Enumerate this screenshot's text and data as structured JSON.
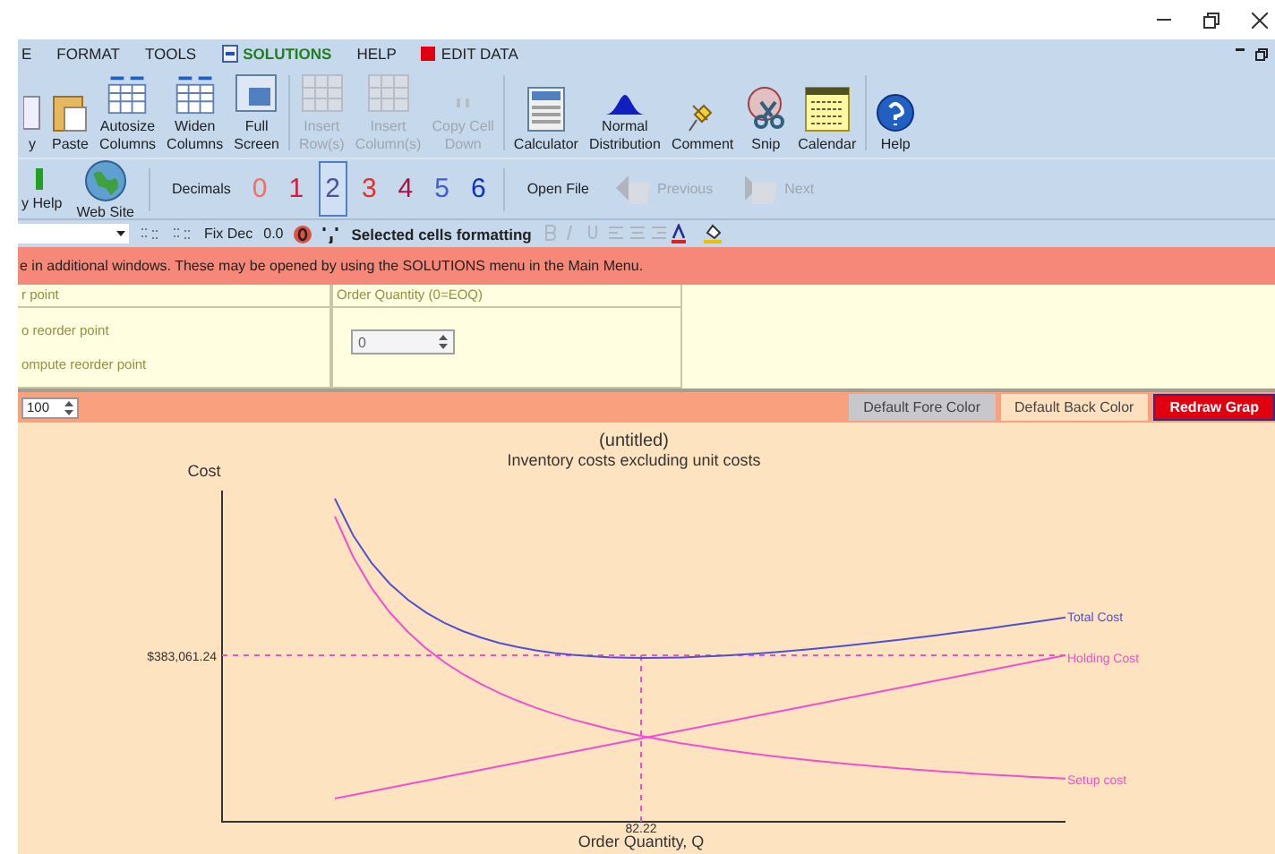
{
  "menu": [
    {
      "label": "E",
      "kind": "plain"
    },
    {
      "label": "FORMAT",
      "kind": "plain"
    },
    {
      "label": "TOOLS",
      "kind": "plain"
    },
    {
      "label": "SOLUTIONS",
      "kind": "solutions"
    },
    {
      "label": "HELP",
      "kind": "plain"
    },
    {
      "label": "EDIT DATA",
      "kind": "edit"
    }
  ],
  "toolbar": [
    {
      "label": "y",
      "kind": "copy",
      "disabled": false
    },
    {
      "label": "Paste",
      "kind": "paste",
      "disabled": false
    },
    {
      "label": "Autosize\nColumns",
      "kind": "grid-arrows",
      "disabled": false
    },
    {
      "label": "Widen\nColumns",
      "kind": "grid-arrows",
      "disabled": false
    },
    {
      "label": "Full\nScreen",
      "kind": "screen",
      "disabled": false
    },
    {
      "label": "Insert\nRow(s)",
      "kind": "grid",
      "disabled": true
    },
    {
      "label": "Insert\nColumn(s)",
      "kind": "grid",
      "disabled": true
    },
    {
      "label": "Copy Cell\nDown",
      "kind": "quote",
      "disabled": true
    },
    {
      "label": "Calculator",
      "kind": "calculator",
      "disabled": false
    },
    {
      "label": "Normal\nDistribution",
      "kind": "bell",
      "disabled": false
    },
    {
      "label": "Comment",
      "kind": "pin",
      "disabled": false
    },
    {
      "label": "Snip",
      "kind": "snip",
      "disabled": false
    },
    {
      "label": "Calendar",
      "kind": "calendar",
      "disabled": false
    },
    {
      "label": "Help",
      "kind": "help",
      "disabled": false
    }
  ],
  "row2": {
    "links": [
      {
        "label": "y Help",
        "kind": "help-link"
      },
      {
        "label": "Web Site",
        "kind": "globe"
      }
    ],
    "decimals_label": "Decimals",
    "decimals": [
      {
        "label": "0",
        "color": "#f07060",
        "selected": false
      },
      {
        "label": "1",
        "color": "#d02040",
        "selected": false
      },
      {
        "label": "2",
        "color": "#5050a0",
        "selected": true
      },
      {
        "label": "3",
        "color": "#e03030",
        "selected": false
      },
      {
        "label": "4",
        "color": "#b01040",
        "selected": false
      },
      {
        "label": "5",
        "color": "#4060d0",
        "selected": false
      },
      {
        "label": "6",
        "color": "#1030c0",
        "selected": false
      }
    ],
    "open_file": "Open File",
    "nav": [
      {
        "label": "Previous",
        "kind": "previous",
        "disabled": true
      },
      {
        "label": "Next",
        "kind": "next",
        "disabled": true
      }
    ]
  },
  "format_bar": {
    "fix_dec": "Fix Dec",
    "zero_dec": "0.0",
    "label": "Selected cells formatting"
  },
  "message": "e in additional windows. These may be opened by using the SOLUTIONS menu in the Main Menu.",
  "panel": {
    "left": {
      "title": "r point",
      "options": [
        "o reorder point",
        "ompute reorder point"
      ]
    },
    "right": {
      "title": "Order Quantity (0=EOQ)",
      "value": "0"
    }
  },
  "graph_bar": {
    "zoom": "100",
    "buttons": [
      {
        "label": "Default Fore Color",
        "kind": "fore"
      },
      {
        "label": "Default Back Color",
        "kind": "back"
      },
      {
        "label": "Redraw Grap",
        "kind": "redraw"
      }
    ]
  },
  "chart": {
    "title": "(untitled)",
    "subtitle": "Inventory costs excluding unit costs",
    "ylabel": "Cost",
    "xlabel": "Order Quantity, Q",
    "y_marker": "$383,061.24",
    "x_marker": "82.22",
    "series": [
      {
        "name": "Total Cost",
        "color": "#5050d0"
      },
      {
        "name": "Holding Cost",
        "color": "#f050d0"
      },
      {
        "name": "Setup cost",
        "color": "#f050d0"
      }
    ]
  }
}
